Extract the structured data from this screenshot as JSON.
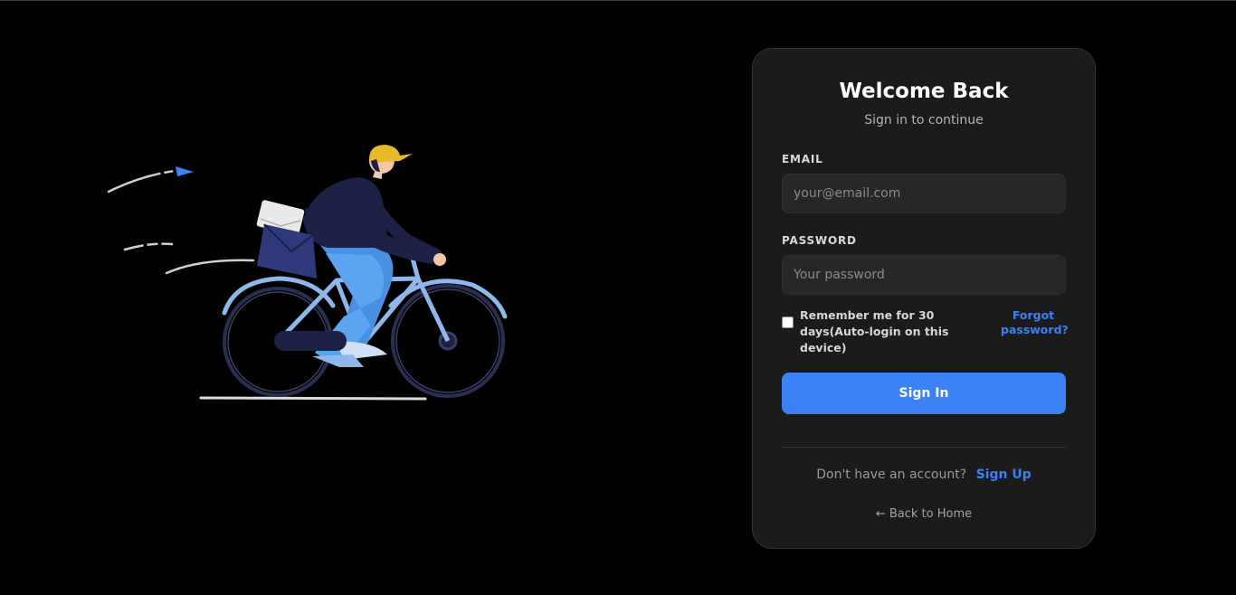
{
  "login": {
    "title": "Welcome Back",
    "subtitle": "Sign in to continue",
    "email_label": "EMAIL",
    "email_placeholder": "your@email.com",
    "email_value": "",
    "password_label": "PASSWORD",
    "password_placeholder": "Your password",
    "password_value": "",
    "remember_label": "Remember me for 30 days(Auto-login on this device)",
    "remember_checked": false,
    "forgot_label": "Forgot password?",
    "signin_label": "Sign In",
    "signup_prompt": "Don't have an account?",
    "signup_label": "Sign Up",
    "back_label": "← Back to Home"
  },
  "illustration": {
    "icon": "cyclist-delivery-illustration"
  },
  "colors": {
    "background": "#000000",
    "card": "#1b1b1b",
    "accent": "#3b82f6",
    "input": "#272727"
  }
}
